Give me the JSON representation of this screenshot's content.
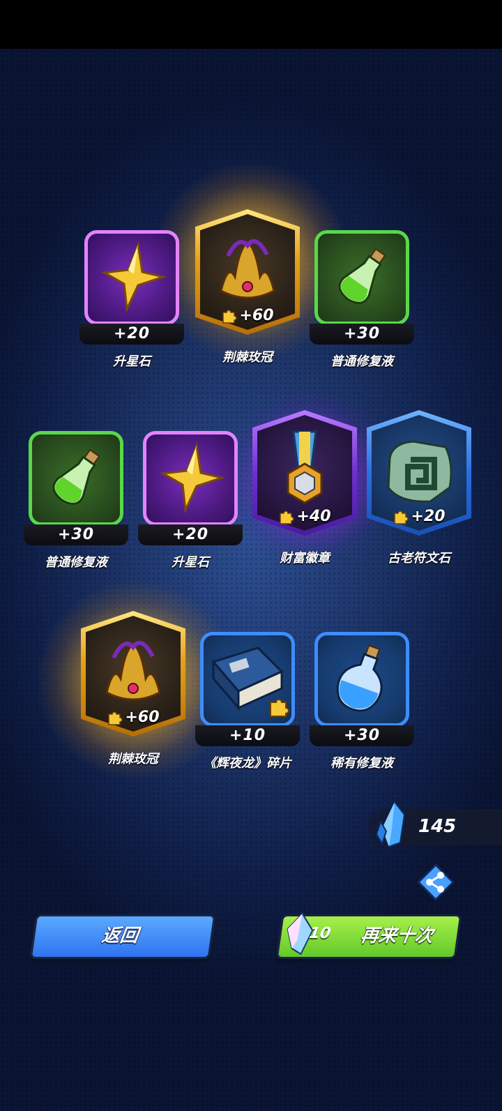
{
  "rewards": [
    {
      "name": "升星石",
      "amount": "+20",
      "frame": "card",
      "rarity": "purple",
      "icon": "star-stone-icon"
    },
    {
      "name": "荆棘玫冠",
      "amount": "+60",
      "frame": "hex",
      "rarity": "gold",
      "icon": "thorn-crown-icon",
      "fragment": true
    },
    {
      "name": "普通修复液",
      "amount": "+30",
      "frame": "card",
      "rarity": "green",
      "icon": "green-potion-icon"
    },
    {
      "name": "普通修复液",
      "amount": "+30",
      "frame": "card",
      "rarity": "green",
      "icon": "green-potion-icon"
    },
    {
      "name": "升星石",
      "amount": "+20",
      "frame": "card",
      "rarity": "purple",
      "icon": "star-stone-icon"
    },
    {
      "name": "财富徽章",
      "amount": "+40",
      "frame": "hex",
      "rarity": "purple",
      "icon": "wealth-medal-icon",
      "fragment": true
    },
    {
      "name": "古老符文石",
      "amount": "+20",
      "frame": "hex",
      "rarity": "blue",
      "icon": "rune-stone-icon",
      "fragment": true
    },
    {
      "name": "荆棘玫冠",
      "amount": "+60",
      "frame": "hex",
      "rarity": "gold",
      "icon": "thorn-crown-icon",
      "fragment": true
    },
    {
      "name": "《辉夜龙》碎片",
      "amount": "+10",
      "frame": "card",
      "rarity": "blue",
      "icon": "book-fragment-icon"
    },
    {
      "name": "稀有修复液",
      "amount": "+30",
      "frame": "card",
      "rarity": "blue",
      "icon": "blue-potion-icon"
    }
  ],
  "currency": {
    "value": "145",
    "icon": "blue-crystal-icon"
  },
  "buttons": {
    "back_label": "返回",
    "again_label": "再来十次",
    "again_cost": "10"
  },
  "colors": {
    "gold": "#f2b020",
    "purple": "#b060ff",
    "green": "#59d84a",
    "blue": "#3f8cff",
    "back": "#3f8cff",
    "again": "#7ad83a"
  }
}
